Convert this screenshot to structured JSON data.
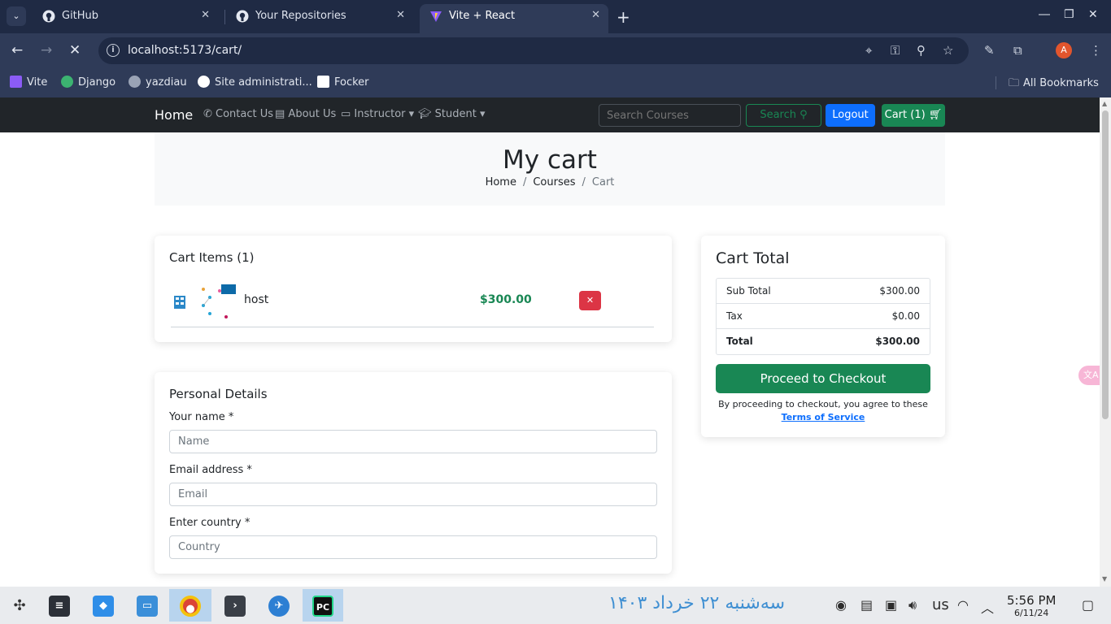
{
  "browser": {
    "tabs": [
      {
        "title": "GitHub",
        "icon": "github-icon"
      },
      {
        "title": "Your Repositories",
        "icon": "github-icon"
      },
      {
        "title": "Vite + React",
        "icon": "vite-icon"
      }
    ],
    "url": "localhost:5173/cart/",
    "bookmarks": [
      {
        "label": "Vite",
        "color": "#8b5cf6"
      },
      {
        "label": "Django",
        "color": "#3cb371"
      },
      {
        "label": "yazdiau",
        "color": "#9aa3b5"
      },
      {
        "label": "Site administrati...",
        "color": "#ffffff"
      },
      {
        "label": "Focker",
        "color": "#ffffff"
      }
    ],
    "all_bookmarks": "All Bookmarks",
    "profile_initial": "A"
  },
  "site": {
    "brand": "Home",
    "nav": [
      {
        "label": "Contact Us",
        "icon": "phone-icon"
      },
      {
        "label": "About Us",
        "icon": "id-card-icon"
      },
      {
        "label": "Instructor",
        "icon": "chalkboard-icon"
      },
      {
        "label": "Student",
        "icon": "graduation-cap-icon"
      }
    ],
    "search_placeholder": "Search Courses",
    "search_label": "Search",
    "logout_label": "Logout",
    "cart_label": "Cart (1)"
  },
  "banner": {
    "title": "My cart",
    "breadcrumb": [
      "Home",
      "Courses",
      "Cart"
    ]
  },
  "cart": {
    "heading": "Cart Items (1)",
    "items": [
      {
        "title": "host",
        "price": "$300.00"
      }
    ]
  },
  "totals": {
    "heading": "Cart Total",
    "rows": [
      {
        "label": "Sub Total",
        "value": "$300.00"
      },
      {
        "label": "Tax",
        "value": "$0.00"
      },
      {
        "label": "Total",
        "value": "$300.00"
      }
    ],
    "checkout_label": "Proceed to Checkout",
    "terms_prefix": "By proceeding to checkout, you agree to these ",
    "terms_link": "Terms of Service"
  },
  "personal": {
    "heading": "Personal Details",
    "fields": [
      {
        "label": "Your name *",
        "placeholder": "Name"
      },
      {
        "label": "Email address *",
        "placeholder": "Email"
      },
      {
        "label": "Enter country *",
        "placeholder": "Country"
      }
    ]
  },
  "taskbar": {
    "persian_date": "سه‌شنبه ۲۲ خرداد ۱۴۰۳",
    "keyboard": "us",
    "time": "5:56 PM",
    "date": "6/11/24"
  },
  "colors": {
    "success": "#198754",
    "primary": "#0d6efd",
    "danger": "#dc3545",
    "navbar": "#212529"
  }
}
